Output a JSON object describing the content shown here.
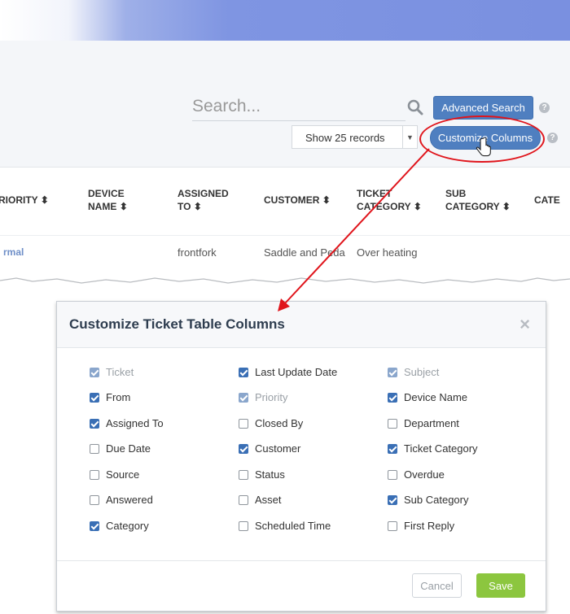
{
  "search": {
    "placeholder": "Search..."
  },
  "toolbar": {
    "advanced_search": "Advanced Search",
    "help": "?",
    "records_select": "Show 25 records",
    "customize_columns": "Customize Columns"
  },
  "table": {
    "headers": [
      {
        "line1": "RIORITY",
        "line2": ""
      },
      {
        "line1": "DEVICE",
        "line2": "NAME"
      },
      {
        "line1": "ASSIGNED",
        "line2": "TO"
      },
      {
        "line1": "CUSTOMER",
        "line2": ""
      },
      {
        "line1": "TICKET",
        "line2": "CATEGORY"
      },
      {
        "line1": "SUB",
        "line2": "CATEGORY"
      },
      {
        "line1": "CATE",
        "line2": ""
      }
    ],
    "sort_glyph": "⬍",
    "row": {
      "priority": "rmal",
      "assigned_to": "frontfork",
      "customer": "Saddle and Peda",
      "ticket_category": "Over heating"
    }
  },
  "modal": {
    "title": "Customize Ticket Table Columns",
    "close": "×",
    "columns": [
      [
        {
          "label": "Ticket",
          "checked": true,
          "disabled": true
        },
        {
          "label": "From",
          "checked": true,
          "disabled": false
        },
        {
          "label": "Assigned To",
          "checked": true,
          "disabled": false
        },
        {
          "label": "Due Date",
          "checked": false,
          "disabled": false
        },
        {
          "label": "Source",
          "checked": false,
          "disabled": false
        },
        {
          "label": "Answered",
          "checked": false,
          "disabled": false
        },
        {
          "label": "Category",
          "checked": true,
          "disabled": false
        }
      ],
      [
        {
          "label": "Last Update Date",
          "checked": true,
          "disabled": false
        },
        {
          "label": "Priority",
          "checked": true,
          "disabled": true
        },
        {
          "label": "Closed By",
          "checked": false,
          "disabled": false
        },
        {
          "label": "Customer",
          "checked": true,
          "disabled": false
        },
        {
          "label": "Status",
          "checked": false,
          "disabled": false
        },
        {
          "label": "Asset",
          "checked": false,
          "disabled": false
        },
        {
          "label": "Scheduled Time",
          "checked": false,
          "disabled": false
        }
      ],
      [
        {
          "label": "Subject",
          "checked": true,
          "disabled": true
        },
        {
          "label": "Device Name",
          "checked": true,
          "disabled": false
        },
        {
          "label": "Department",
          "checked": false,
          "disabled": false
        },
        {
          "label": "Ticket Category",
          "checked": true,
          "disabled": false
        },
        {
          "label": "Overdue",
          "checked": false,
          "disabled": false
        },
        {
          "label": "Sub Category",
          "checked": true,
          "disabled": false
        },
        {
          "label": "First Reply",
          "checked": false,
          "disabled": false
        }
      ]
    ],
    "cancel": "Cancel",
    "save": "Save"
  },
  "colors": {
    "accent": "#4f7fc0",
    "checkbox": "#3a6fb5",
    "save": "#8cc63f",
    "callout": "#e0151c"
  }
}
